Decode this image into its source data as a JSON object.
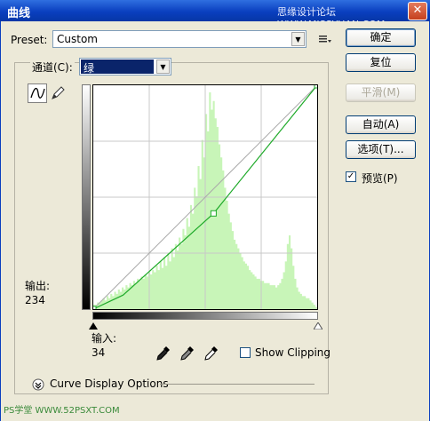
{
  "window": {
    "title": "曲线",
    "watermark": "思缘设计论坛 WWW.MISSYUAN.COM",
    "close_glyph": "✕"
  },
  "preset": {
    "label": "Preset:",
    "value": "Custom"
  },
  "channel": {
    "label": "通道(C):",
    "value": "绿"
  },
  "buttons": {
    "ok": "确定",
    "reset": "复位",
    "smooth": "平滑(M)",
    "auto": "自动(A)",
    "options": "选项(T)..."
  },
  "preview": {
    "label": "预览(P)",
    "checked": true
  },
  "output": {
    "label": "输出:",
    "value": "234"
  },
  "input": {
    "label": "输入:",
    "value": "34"
  },
  "show_clipping": {
    "label": "Show Clipping",
    "checked": false
  },
  "curve_display": {
    "label": "Curve Display Options"
  },
  "footer_watermark": "PS学堂 WWW.52PSXT.COM",
  "colors": {
    "curve": "#1faa2a",
    "histogram": "#c8f5b8",
    "accent": "#0a246a"
  },
  "histogram": [
    2,
    2,
    3,
    3,
    4,
    5,
    4,
    6,
    5,
    7,
    6,
    8,
    7,
    9,
    8,
    10,
    9,
    11,
    10,
    12,
    11,
    13,
    12,
    14,
    13,
    15,
    14,
    16,
    15,
    17,
    16,
    18,
    17,
    20,
    18,
    22,
    19,
    24,
    20,
    26,
    22,
    28,
    24,
    30,
    27,
    33,
    30,
    37,
    34,
    42,
    38,
    48,
    44,
    56,
    52,
    66,
    60,
    78,
    70,
    90,
    82,
    100,
    92,
    96,
    88,
    84,
    76,
    70,
    64,
    56,
    50,
    44,
    40,
    36,
    32,
    30,
    28,
    26,
    24,
    22,
    21,
    20,
    18,
    17,
    16,
    15,
    14,
    14,
    13,
    13,
    12,
    12,
    12,
    11,
    11,
    11,
    10,
    11,
    12,
    14,
    17,
    22,
    30,
    34,
    28,
    20,
    14,
    10,
    8,
    7,
    6,
    6,
    5,
    5,
    4,
    3,
    2,
    1
  ],
  "curve_points": [
    [
      0,
      0
    ],
    [
      34,
      16
    ],
    [
      137,
      109
    ],
    [
      255,
      255
    ]
  ]
}
